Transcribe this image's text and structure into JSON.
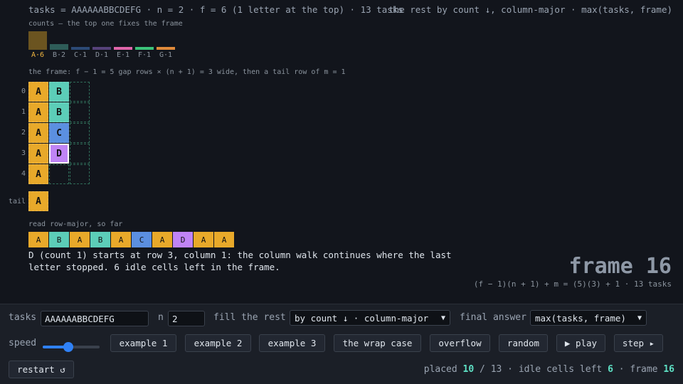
{
  "header": {
    "left": "tasks = AAAAAABBCDEFG · n = 2 · f = 6 (1 letter at the top) · 13 tasks",
    "right": "the rest by count ↓, column-major · max(tasks, frame)"
  },
  "counts": {
    "caption": "counts — the top one fixes the frame",
    "items": [
      {
        "label": "A·6",
        "count": 6,
        "color": "#6b5420",
        "label_color": "#f2b740"
      },
      {
        "label": "B·2",
        "count": 2,
        "color": "#2e5c58",
        "label_color": "#8b949e"
      },
      {
        "label": "C·1",
        "count": 1,
        "color": "#2c4a76",
        "label_color": "#8b949e"
      },
      {
        "label": "D·1",
        "count": 1,
        "color": "#56427a",
        "label_color": "#8b949e"
      },
      {
        "label": "E·1",
        "count": 1,
        "color": "#e066aa",
        "label_color": "#8b949e"
      },
      {
        "label": "F·1",
        "count": 1,
        "color": "#3cc47a",
        "label_color": "#8b949e"
      },
      {
        "label": "G·1",
        "count": 1,
        "color": "#e08a3a",
        "label_color": "#8b949e"
      }
    ]
  },
  "frame": {
    "caption": "the frame: f − 1 = 5 gap rows × (n + 1) = 3 wide, then a tail row of m = 1",
    "row_labels": [
      "0",
      "1",
      "2",
      "3",
      "4"
    ],
    "tail_label": "tail",
    "columns": 3,
    "rows": [
      [
        "A",
        "B",
        ""
      ],
      [
        "A",
        "B",
        ""
      ],
      [
        "A",
        "C",
        ""
      ],
      [
        "A",
        "D",
        ""
      ],
      [
        "A",
        "",
        ""
      ]
    ],
    "tail": [
      "A"
    ],
    "current": {
      "row": 3,
      "col": 1
    }
  },
  "letter_colors": {
    "A": "#e8a92a",
    "B": "#5ccdb8",
    "C": "#5b8fe0",
    "D": "#c084f5"
  },
  "readout": {
    "caption": "read row-major, so far",
    "sequence": [
      "A",
      "B",
      "A",
      "B",
      "A",
      "C",
      "A",
      "D",
      "A",
      "A"
    ]
  },
  "explain": "D (count 1) starts at row 3, column 1: the column walk continues where the last letter stopped. 6 idle cells left in the frame.",
  "frame_title": "frame 16",
  "frame_formula": "(f − 1)(n + 1) + m = (5)(3) + 1 · 13 tasks",
  "controls": {
    "tasks_label": "tasks",
    "tasks_value": "AAAAAABBCDEFG",
    "n_label": "n",
    "n_value": "2",
    "fill_label": "fill the rest",
    "fill_value": "by count ↓ · column-major",
    "final_label": "final answer",
    "final_value": "max(tasks, frame)",
    "speed_label": "speed",
    "speed_value": 0.45,
    "buttons": [
      "example 1",
      "example 2",
      "example 3",
      "the wrap case",
      "overflow",
      "random",
      "▶ play",
      "step ▸"
    ],
    "restart": "restart ↺"
  },
  "status": {
    "placed_label": "placed",
    "placed": "10",
    "sep": "/",
    "total": "13",
    "idle_label": "· idle cells left",
    "idle": "6",
    "frame_label": "· frame",
    "frame": "16"
  }
}
